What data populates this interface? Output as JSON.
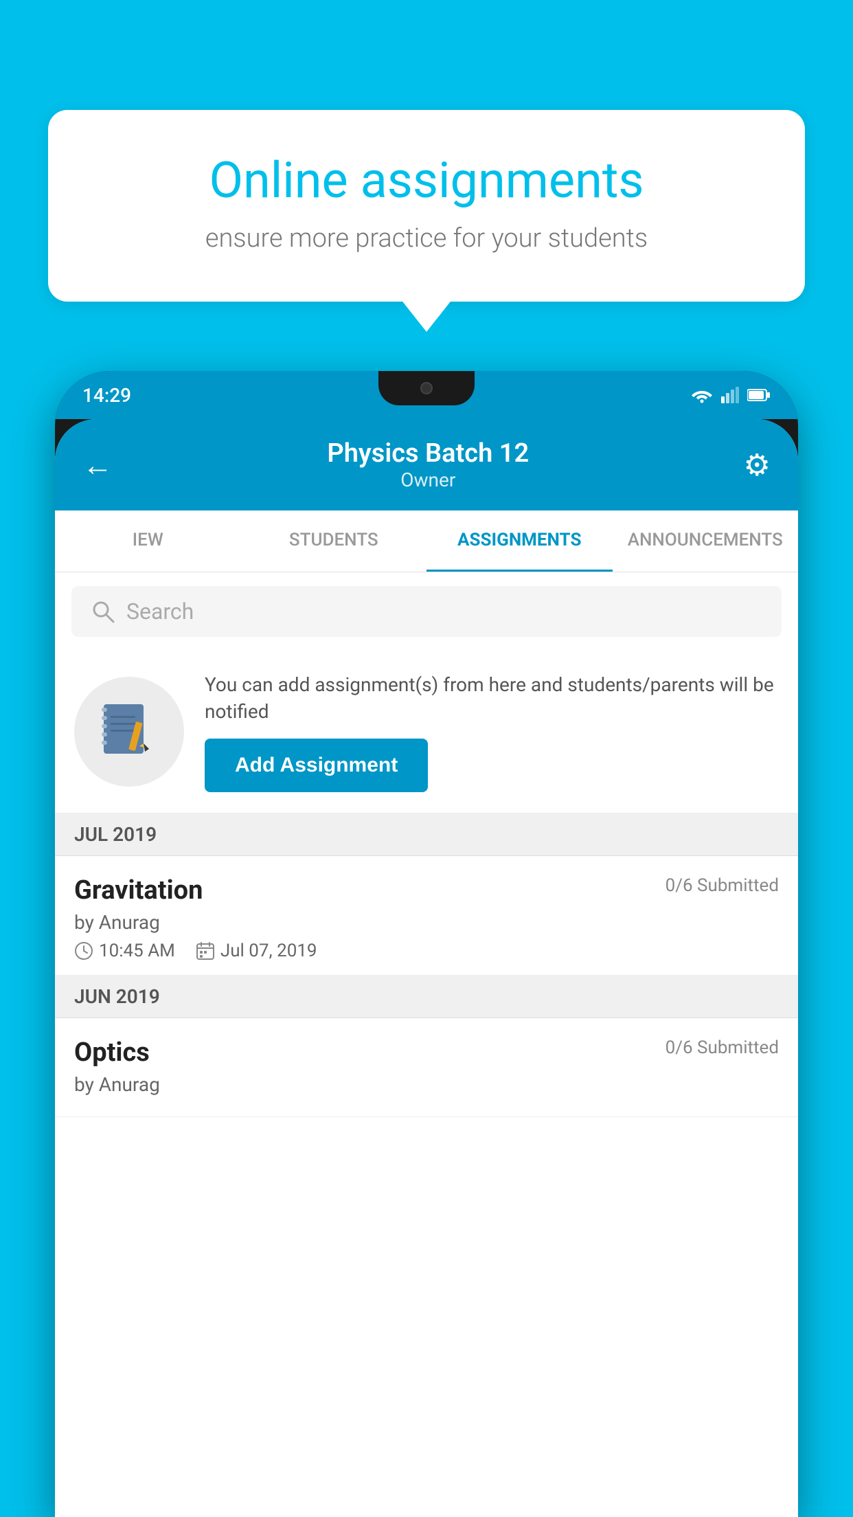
{
  "background_color": "#00BFEA",
  "speech_bubble": {
    "title": "Online assignments",
    "subtitle": "ensure more practice for your students"
  },
  "phone": {
    "status_bar": {
      "time": "14:29",
      "icons": [
        "wifi",
        "signal",
        "battery"
      ]
    },
    "header": {
      "title": "Physics Batch 12",
      "subtitle": "Owner",
      "back_label": "←",
      "settings_label": "⚙"
    },
    "tabs": [
      {
        "label": "IEW",
        "active": false
      },
      {
        "label": "STUDENTS",
        "active": false
      },
      {
        "label": "ASSIGNMENTS",
        "active": true
      },
      {
        "label": "ANNOUNCEMENTS",
        "active": false
      }
    ],
    "search": {
      "placeholder": "Search"
    },
    "promo": {
      "description": "You can add assignment(s) from here and students/parents will be notified",
      "button_label": "Add Assignment"
    },
    "sections": [
      {
        "header": "JUL 2019",
        "items": [
          {
            "title": "Gravitation",
            "status": "0/6 Submitted",
            "by": "by Anurag",
            "time": "10:45 AM",
            "date": "Jul 07, 2019"
          }
        ]
      },
      {
        "header": "JUN 2019",
        "items": [
          {
            "title": "Optics",
            "status": "0/6 Submitted",
            "by": "by Anurag",
            "time": "",
            "date": ""
          }
        ]
      }
    ]
  }
}
